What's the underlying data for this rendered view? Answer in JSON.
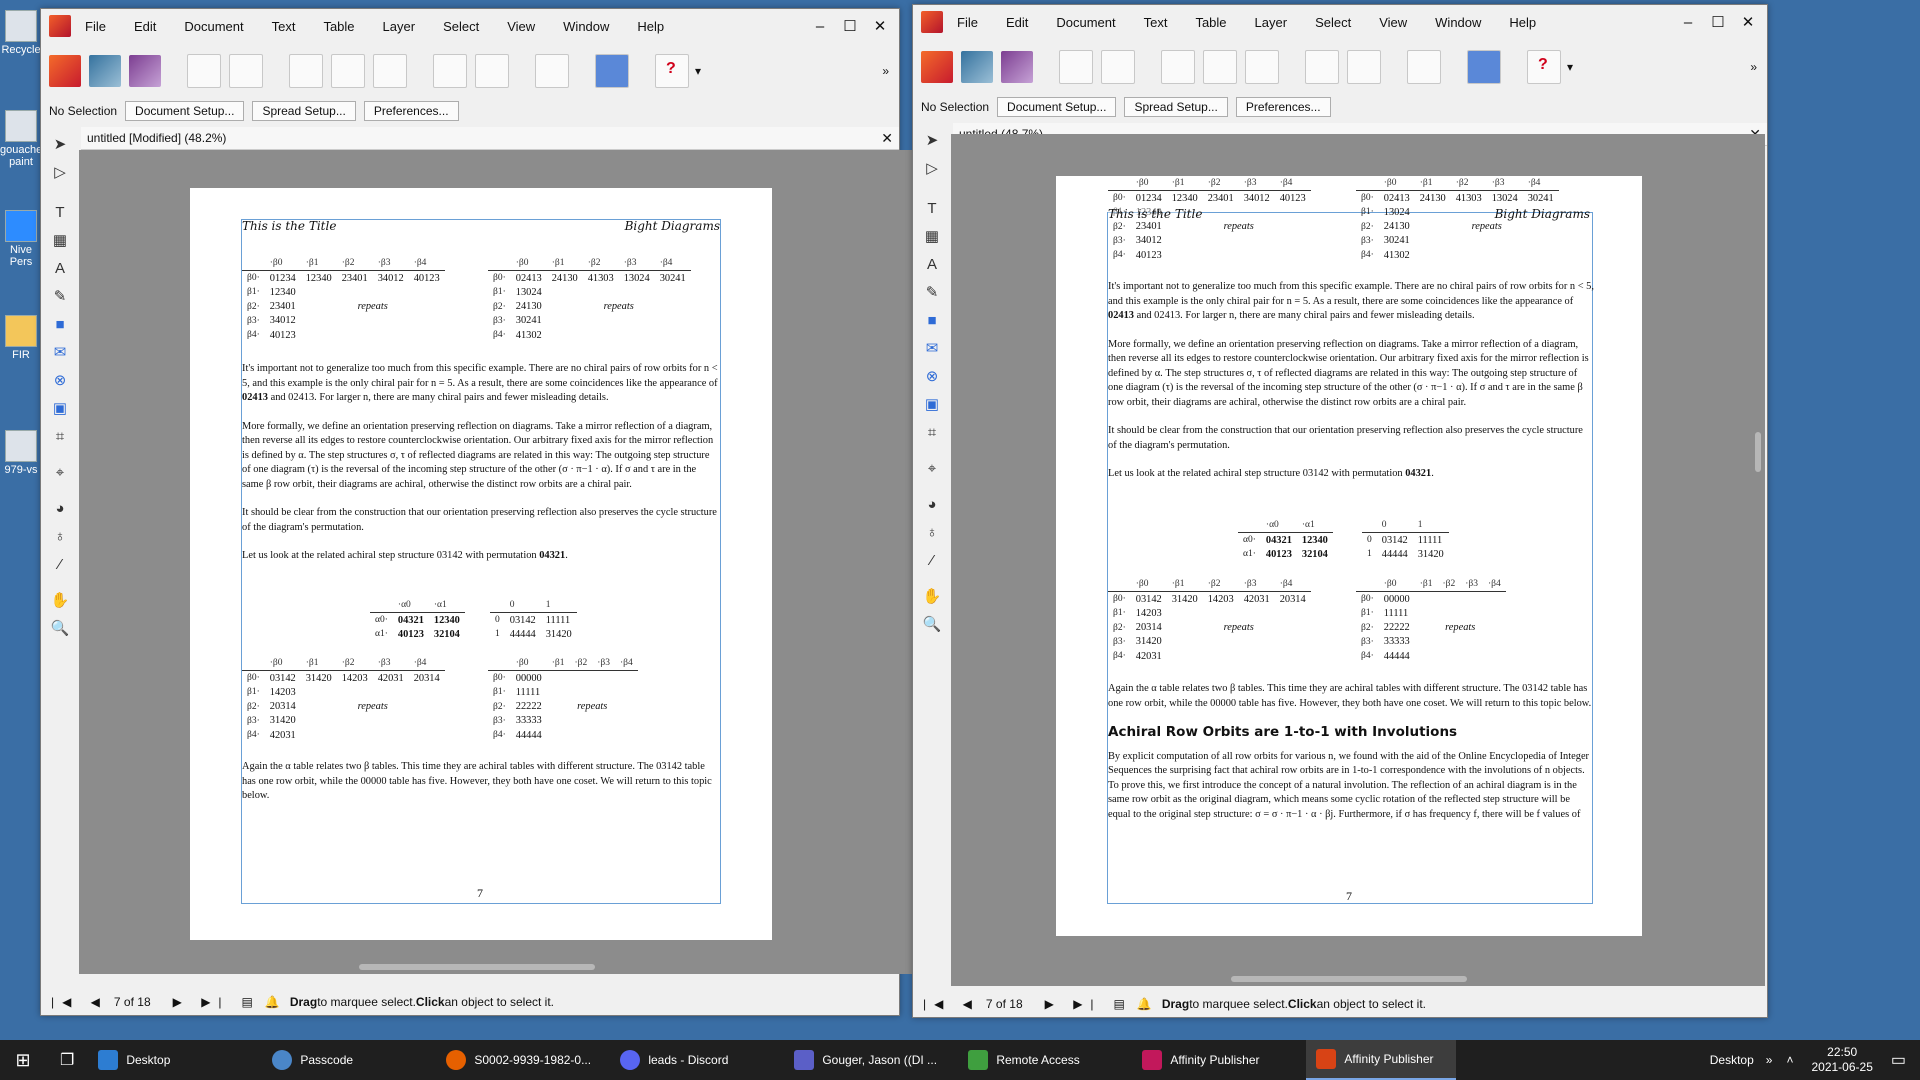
{
  "desktop": {
    "icons": [
      {
        "label": "Recycle"
      },
      {
        "label": "gouache paint"
      },
      {
        "label": "Nive Pers"
      },
      {
        "label": "FIR"
      },
      {
        "label": "979-vs"
      }
    ]
  },
  "app": {
    "menu": [
      "File",
      "Edit",
      "Document",
      "Text",
      "Table",
      "Layer",
      "Select",
      "View",
      "Window",
      "Help"
    ],
    "context": {
      "no_selection": "No Selection",
      "document_setup": "Document Setup...",
      "spread_setup": "Spread Setup...",
      "preferences": "Preferences..."
    },
    "status": {
      "drag": "Drag",
      "marquee": " to marquee select. ",
      "click": "Click",
      "select_rest": " an object to select it."
    }
  },
  "left_window": {
    "tab_title": "untitled [Modified] (48.2%)",
    "page_indicator": "7 of 18"
  },
  "right_window": {
    "tab_title": "untitled (48.7%)",
    "page_indicator": "7 of 18"
  },
  "document": {
    "header_left": "This is the Title",
    "header_right": "Bight Diagrams",
    "page_number": "7",
    "beta_cols": [
      "·β0",
      "·β1",
      "·β2",
      "·β3",
      "·β4"
    ],
    "beta_rows": [
      "β0·",
      "β1·",
      "β2·",
      "β3·",
      "β4·"
    ],
    "repeats": "repeats",
    "t1": {
      "row0": [
        "01234",
        "12340",
        "23401",
        "34012",
        "40123"
      ],
      "col": [
        "12340",
        "23401",
        "34012",
        "40123"
      ]
    },
    "t2": {
      "row0": [
        "02413",
        "24130",
        "41303",
        "13024",
        "30241"
      ],
      "col": [
        "13024",
        "24130",
        "30241",
        "41302"
      ]
    },
    "t3": {
      "row0": [
        "03142",
        "31420",
        "14203",
        "42031",
        "20314"
      ],
      "col": [
        "14203",
        "20314",
        "31420",
        "42031"
      ]
    },
    "t4": {
      "row0": [
        "00000"
      ],
      "col": [
        "11111",
        "22222",
        "33333",
        "44444"
      ]
    },
    "alpha": {
      "cols": [
        "·α0",
        "·α1"
      ],
      "rows": [
        "α0·",
        "α1·"
      ],
      "r0": [
        "04321",
        "12340"
      ],
      "r1": [
        "40123",
        "32104"
      ]
    },
    "coset": {
      "cols": [
        "0",
        "1"
      ],
      "r0": [
        "0",
        "03142",
        "11111"
      ],
      "r1": [
        "1",
        "44444",
        "31420"
      ]
    },
    "p1": [
      "It's important not to generalize too much from this specific example.  There are no chiral pairs of row orbits for n < 5, and this example is the only chiral pair for n = 5.  As a result, there are some coincidences like the appearance of ",
      "02413",
      " and 02413.  For larger n, there are many chiral pairs and fewer misleading details."
    ],
    "p2": "More formally, we define an orientation preserving reflection on diagrams. Take a mirror reflection of a diagram, then reverse all its edges to restore counterclockwise orientation.  Our arbitrary fixed axis for the mirror reflection is defined by α.  The step structures σ, τ of reflected diagrams are related in this way:  The outgoing step structure of one diagram (τ) is the reversal of the incoming step structure of the other (σ · π−1 · α).  If σ and τ are in the same β row orbit, their diagrams are achiral, otherwise the distinct row orbits are a chiral pair.",
    "p3": "It should be clear from the construction that our orientation preserving reflection also preserves the cycle structure of the diagram's permutation.",
    "p4": [
      "Let us look at the related achiral step structure 03142 with permutation ",
      "04321",
      "."
    ],
    "p5": "Again the α table relates two β tables.  This time they are achiral tables with different structure. The 03142 table has one row orbit, while the 00000 table has five.  However, they both have one coset. We will return to this topic below.",
    "heading": "Achiral Row Orbits are 1-to-1 with Involutions",
    "p6": "By explicit computation of all row orbits for various n, we found with the aid of the Online Encyclopedia of Integer Sequences the surprising fact that achiral row orbits are in 1-to-1 correspondence with the involutions of n objects.  To prove this, we first introduce the concept of a natural involution. The reflection of an achiral diagram is in the same row orbit as the original diagram, which means some cyclic rotation of the reflected step structure will be equal to the original step structure:  σ = σ · π−1 · α · βj.  Furthermore, if σ has frequency f, there will be f values of"
  },
  "taskbar": {
    "items": [
      {
        "label": "Desktop",
        "color": "#2d7dd2"
      },
      {
        "label": "Passcode",
        "color": "#4a86c8"
      },
      {
        "label": "S0002-9939-1982-0...",
        "color": "#e66000"
      },
      {
        "label": "leads - Discord",
        "color": "#5865f2"
      },
      {
        "label": "Gouger, Jason ((DI ...",
        "color": "#5b5fc7"
      },
      {
        "label": "Remote Access",
        "color": "#3f9f3f"
      },
      {
        "label": "Affinity Publisher",
        "color": "#c2185b"
      },
      {
        "label": "Affinity Publisher",
        "color": "#d84315"
      }
    ],
    "tray_label": "Desktop",
    "time": "22:50",
    "date": "2021-06-25"
  }
}
